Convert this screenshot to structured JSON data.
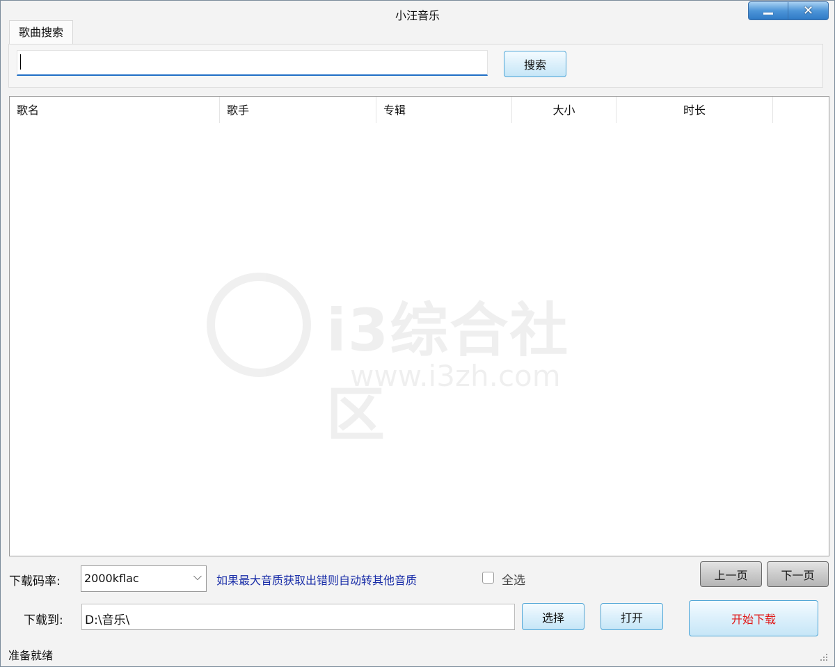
{
  "window": {
    "title": "小汪音乐",
    "minimize_icon": "minimize-icon",
    "close_icon": "close-icon"
  },
  "tab": {
    "label": "歌曲搜索"
  },
  "search": {
    "value": "",
    "button_label": "搜索"
  },
  "table": {
    "columns": [
      "歌名",
      "歌手",
      "专辑",
      "大小",
      "时长"
    ],
    "rows": []
  },
  "watermark": {
    "name": "i3综合社区",
    "url": "www.i3zh.com"
  },
  "bitrate": {
    "label": "下载码率:",
    "selected": "2000kflac",
    "note": "如果最大音质获取出错则自动转其他音质"
  },
  "select_all": {
    "label": "全选",
    "checked": false
  },
  "pagination": {
    "prev_label": "上一页",
    "next_label": "下一页"
  },
  "download": {
    "label": "下载到:",
    "path": "D:\\音乐\\",
    "choose_label": "选择",
    "open_label": "打开",
    "start_label": "开始下载",
    "start_color": "#e01818"
  },
  "status": {
    "text": "准备就绪"
  }
}
